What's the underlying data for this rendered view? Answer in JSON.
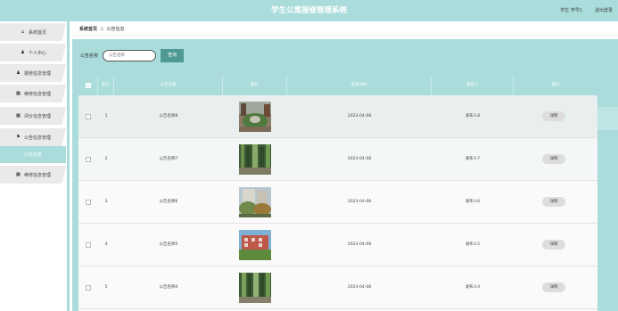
{
  "header": {
    "title": "学生公寓报修管理系统",
    "user": "学生 学号1",
    "logout": "退出登录"
  },
  "sidebar": {
    "items": [
      {
        "label": "系统首页",
        "icon": "home-icon",
        "glyph": "⌂"
      },
      {
        "label": "个人中心",
        "icon": "person-icon",
        "glyph": "♟"
      },
      {
        "label": "报修信息管理",
        "icon": "person-icon",
        "glyph": "♟"
      },
      {
        "label": "维修信息管理",
        "icon": "grid-icon",
        "glyph": "▦"
      },
      {
        "label": "评价信息管理",
        "icon": "grid-icon",
        "glyph": "▦"
      },
      {
        "label": "公告信息管理",
        "icon": "flag-icon",
        "glyph": "⚑"
      },
      {
        "label": "公告信息",
        "icon": "",
        "glyph": ""
      },
      {
        "label": "维修信息管理",
        "icon": "grid-icon",
        "glyph": "▦"
      }
    ]
  },
  "breadcrumb": {
    "home": "系统首页",
    "current": "公告信息"
  },
  "search": {
    "label": "公告名称",
    "placeholder": "公告名称",
    "button": "查询"
  },
  "table": {
    "columns": [
      "索引",
      "公告名称",
      "图片",
      "发布时间",
      "发布人",
      "操作"
    ],
    "rows": [
      {
        "index": "1",
        "name": "公告名称8",
        "date": "2023-04-08",
        "publisher": "发布人8",
        "action": "详情"
      },
      {
        "index": "2",
        "name": "公告名称7",
        "date": "2023-04-08",
        "publisher": "发布人7",
        "action": "详情"
      },
      {
        "index": "3",
        "name": "公告名称6",
        "date": "2023-04-08",
        "publisher": "发布人6",
        "action": "详情"
      },
      {
        "index": "4",
        "name": "公告名称5",
        "date": "2023-04-08",
        "publisher": "发布人5",
        "action": "详情"
      },
      {
        "index": "5",
        "name": "公告名称4",
        "date": "2023-04-08",
        "publisher": "发布人4",
        "action": "详情"
      }
    ]
  },
  "colors": {
    "accent": "#a9dcdb",
    "button": "#4e9a93"
  }
}
